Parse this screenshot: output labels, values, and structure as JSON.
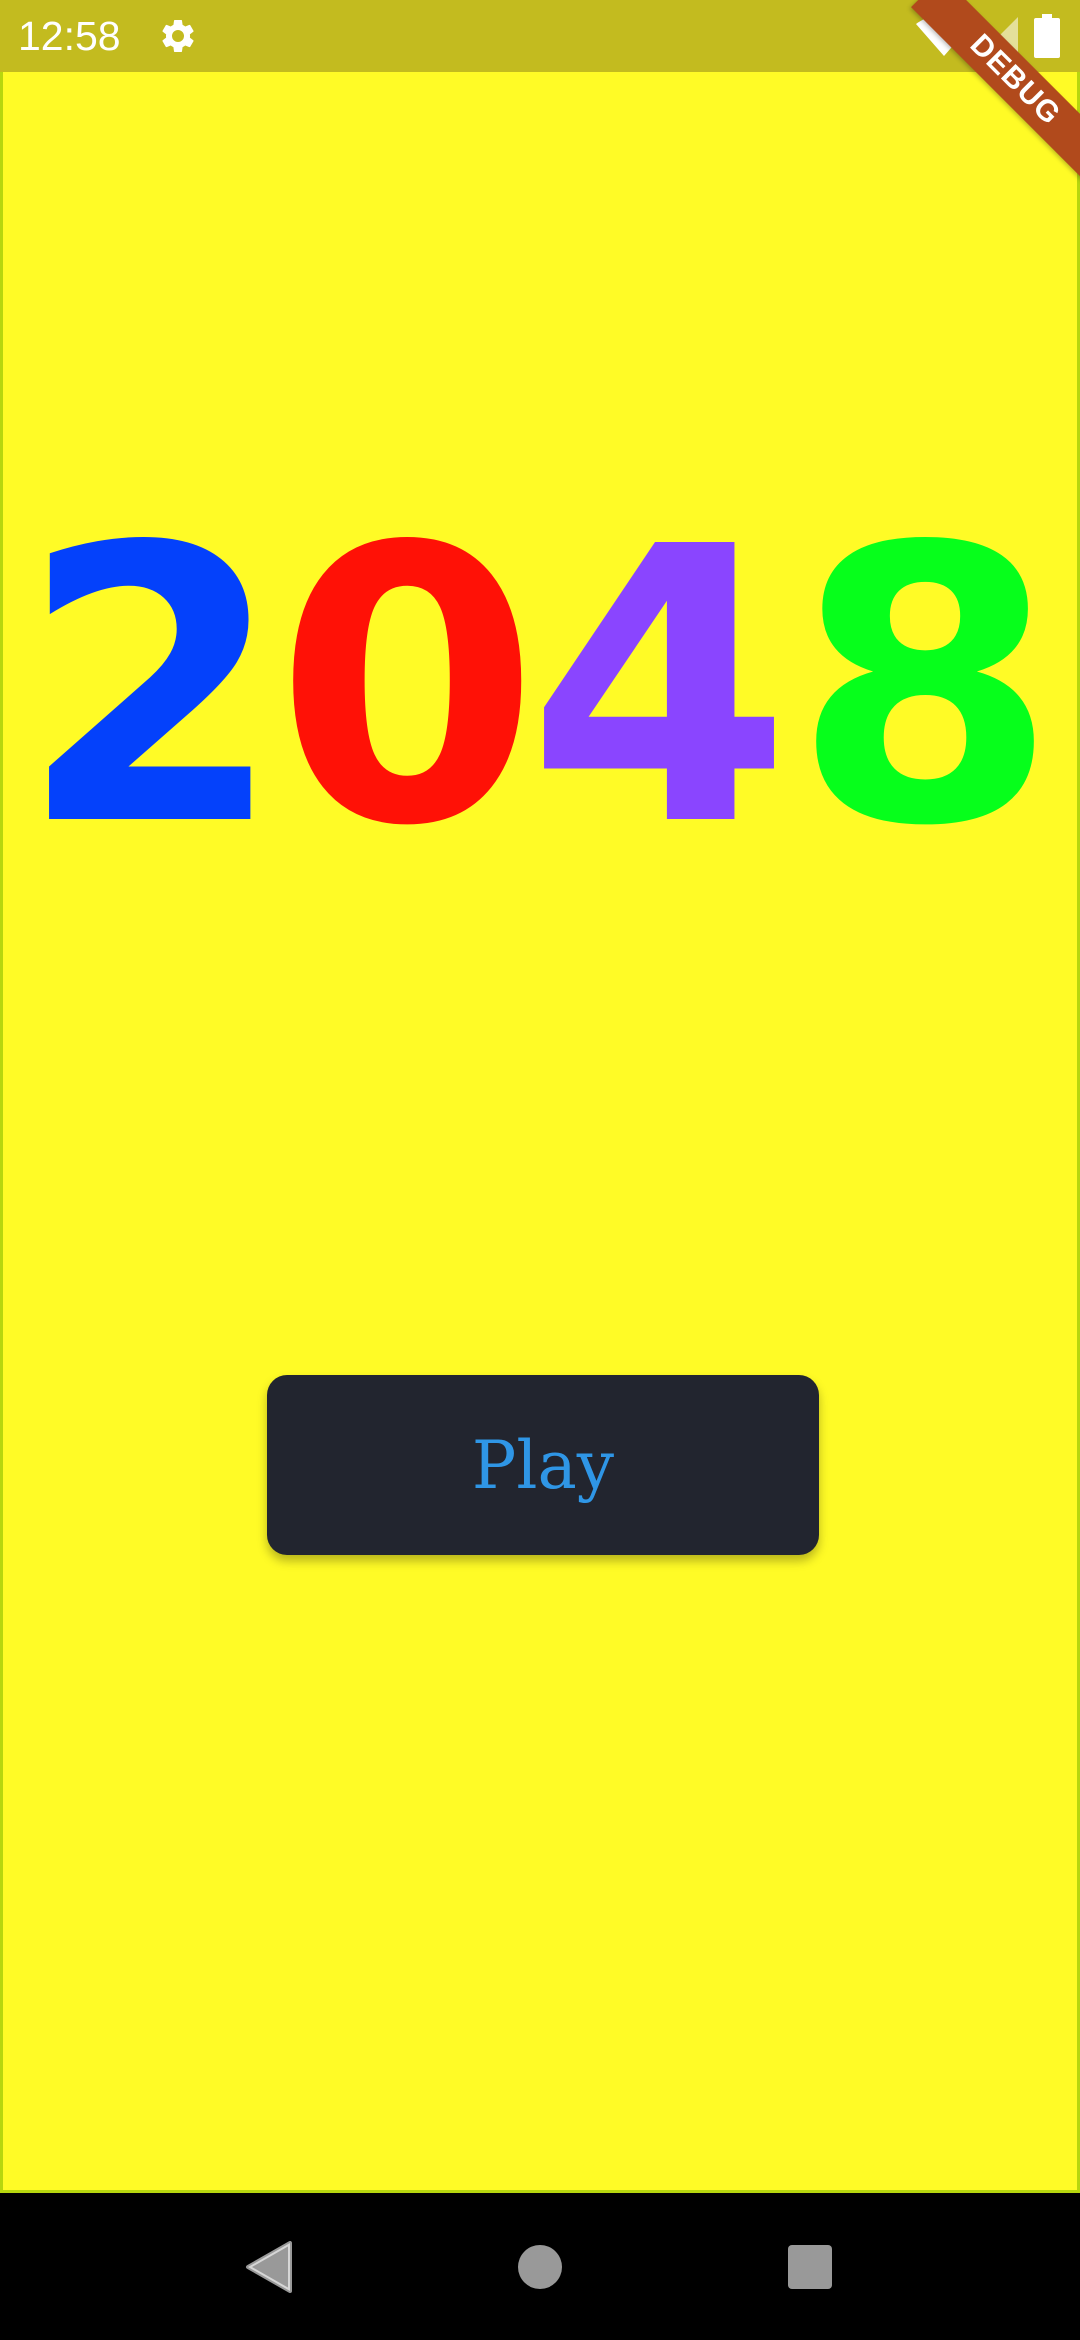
{
  "status_bar": {
    "time": "12:58",
    "icons": [
      "gear-icon",
      "wifi-icon",
      "signal-icon",
      "battery-icon"
    ]
  },
  "debug_banner": {
    "label": "DEBUG",
    "color": "#b14a1c"
  },
  "title": {
    "digits": [
      {
        "char": "2",
        "color": "#0441fb"
      },
      {
        "char": "0",
        "color": "#ff1106"
      },
      {
        "char": "4",
        "color": "#8a45ff"
      },
      {
        "char": "8",
        "color": "#06ff1b"
      }
    ]
  },
  "play_button": {
    "label": "Play",
    "text_color": "#2f96e6",
    "background": "#22252f"
  },
  "nav_bar": {
    "buttons": [
      "back-icon",
      "home-icon",
      "recents-icon"
    ]
  },
  "colors": {
    "background": "#fffb26",
    "status_bar": "#c3bb1f"
  }
}
